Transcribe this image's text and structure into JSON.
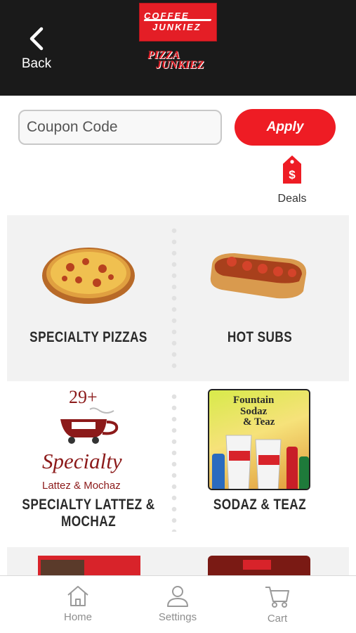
{
  "header": {
    "back_label": "Back",
    "logo_coffee_line1": "COFFEE",
    "logo_coffee_line2": "JUNKIEZ",
    "logo_pizza_line1": "PIZZA",
    "logo_pizza_line2": "JUNKIEZ"
  },
  "coupon": {
    "placeholder": "Coupon Code",
    "apply_label": "Apply"
  },
  "deals": {
    "label": "Deals"
  },
  "categories": [
    {
      "label": "SPECIALTY PIZZAS"
    },
    {
      "label": "HOT SUBS"
    },
    {
      "label": "SPECIALTY LATTEZ & MOCHAZ",
      "badge": "29+",
      "script_text": "Specialty",
      "sub_text": "Lattez & Mochaz"
    },
    {
      "label": "SODAZ & TEAZ",
      "promo_line1": "Fountain",
      "promo_line2": "Sodaz",
      "promo_line3": "& Teaz"
    }
  ],
  "tabs": [
    {
      "label": "Home"
    },
    {
      "label": "Settings"
    },
    {
      "label": "Cart"
    }
  ],
  "colors": {
    "accent": "#ee1c24",
    "header_bg": "#1a1a1a",
    "tile_bg": "#f2f2f2"
  }
}
